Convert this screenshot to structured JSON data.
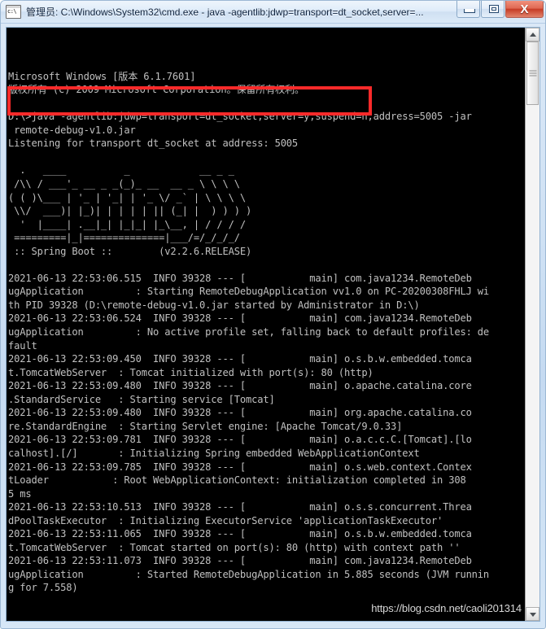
{
  "window": {
    "title": "管理员: C:\\Windows\\System32\\cmd.exe - java  -agentlib:jdwp=transport=dt_socket,server=...",
    "icon": "cmd-console-icon",
    "buttons": {
      "minimize": "–",
      "maximize": "□",
      "close": "X"
    }
  },
  "console": {
    "background_color": "#000000",
    "text_color": "#c0c0c0",
    "lines": [
      "Microsoft Windows [版本 6.1.7601]",
      "版权所有 (c) 2009 Microsoft Corporation。保留所有权利。",
      "",
      "D:\\>java -agentlib:jdwp=transport=dt_socket,server=y,suspend=n,address=5005 -jar",
      " remote-debug-v1.0.jar",
      "Listening for transport dt_socket at address: 5005",
      "",
      "  .   ____          _            __ _ _",
      " /\\\\ / ___'_ __ _ _(_)_ __  __ _ \\ \\ \\ \\",
      "( ( )\\___ | '_ | '_| | '_ \\/ _` | \\ \\ \\ \\",
      " \\\\/  ___)| |_)| | | | | || (_| |  ) ) ) )",
      "  '  |____| .__|_| |_|_| |_\\__, | / / / /",
      " =========|_|==============|___/=/_/_/_/",
      " :: Spring Boot ::        (v2.2.6.RELEASE)",
      "",
      "2021-06-13 22:53:06.515  INFO 39328 --- [           main] com.java1234.RemoteDeb",
      "ugApplication         : Starting RemoteDebugApplication vv1.0 on PC-20200308FHLJ wi",
      "th PID 39328 (D:\\remote-debug-v1.0.jar started by Administrator in D:\\)",
      "2021-06-13 22:53:06.524  INFO 39328 --- [           main] com.java1234.RemoteDeb",
      "ugApplication         : No active profile set, falling back to default profiles: de",
      "fault",
      "2021-06-13 22:53:09.450  INFO 39328 --- [           main] o.s.b.w.embedded.tomca",
      "t.TomcatWebServer  : Tomcat initialized with port(s): 80 (http)",
      "2021-06-13 22:53:09.480  INFO 39328 --- [           main] o.apache.catalina.core",
      ".StandardService   : Starting service [Tomcat]",
      "2021-06-13 22:53:09.480  INFO 39328 --- [           main] org.apache.catalina.co",
      "re.StandardEngine  : Starting Servlet engine: [Apache Tomcat/9.0.33]",
      "2021-06-13 22:53:09.781  INFO 39328 --- [           main] o.a.c.c.C.[Tomcat].[lo",
      "calhost].[/]       : Initializing Spring embedded WebApplicationContext",
      "2021-06-13 22:53:09.785  INFO 39328 --- [           main] o.s.web.context.Contex",
      "tLoader           : Root WebApplicationContext: initialization completed in 308",
      "5 ms",
      "2021-06-13 22:53:10.513  INFO 39328 --- [           main] o.s.s.concurrent.Threa",
      "dPoolTaskExecutor  : Initializing ExecutorService 'applicationTaskExecutor'",
      "2021-06-13 22:53:11.065  INFO 39328 --- [           main] o.s.b.w.embedded.tomca",
      "t.TomcatWebServer  : Tomcat started on port(s): 80 (http) with context path ''",
      "2021-06-13 22:53:11.073  INFO 39328 --- [           main] com.java1234.RemoteDeb",
      "ugApplication         : Started RemoteDebugApplication in 5.885 seconds (JVM runnin",
      "g for 7.558)"
    ]
  },
  "annotation": {
    "highlight_color": "#f92a2a",
    "highlighted_text": "Listening for transport dt_socket at address: 5005"
  },
  "watermark": {
    "text": "https://blog.csdn.net/caoli201314"
  },
  "scrollbar": {
    "up_arrow": "scroll-up-arrow",
    "down_arrow": "scroll-down-arrow",
    "thumb": "scroll-thumb"
  }
}
